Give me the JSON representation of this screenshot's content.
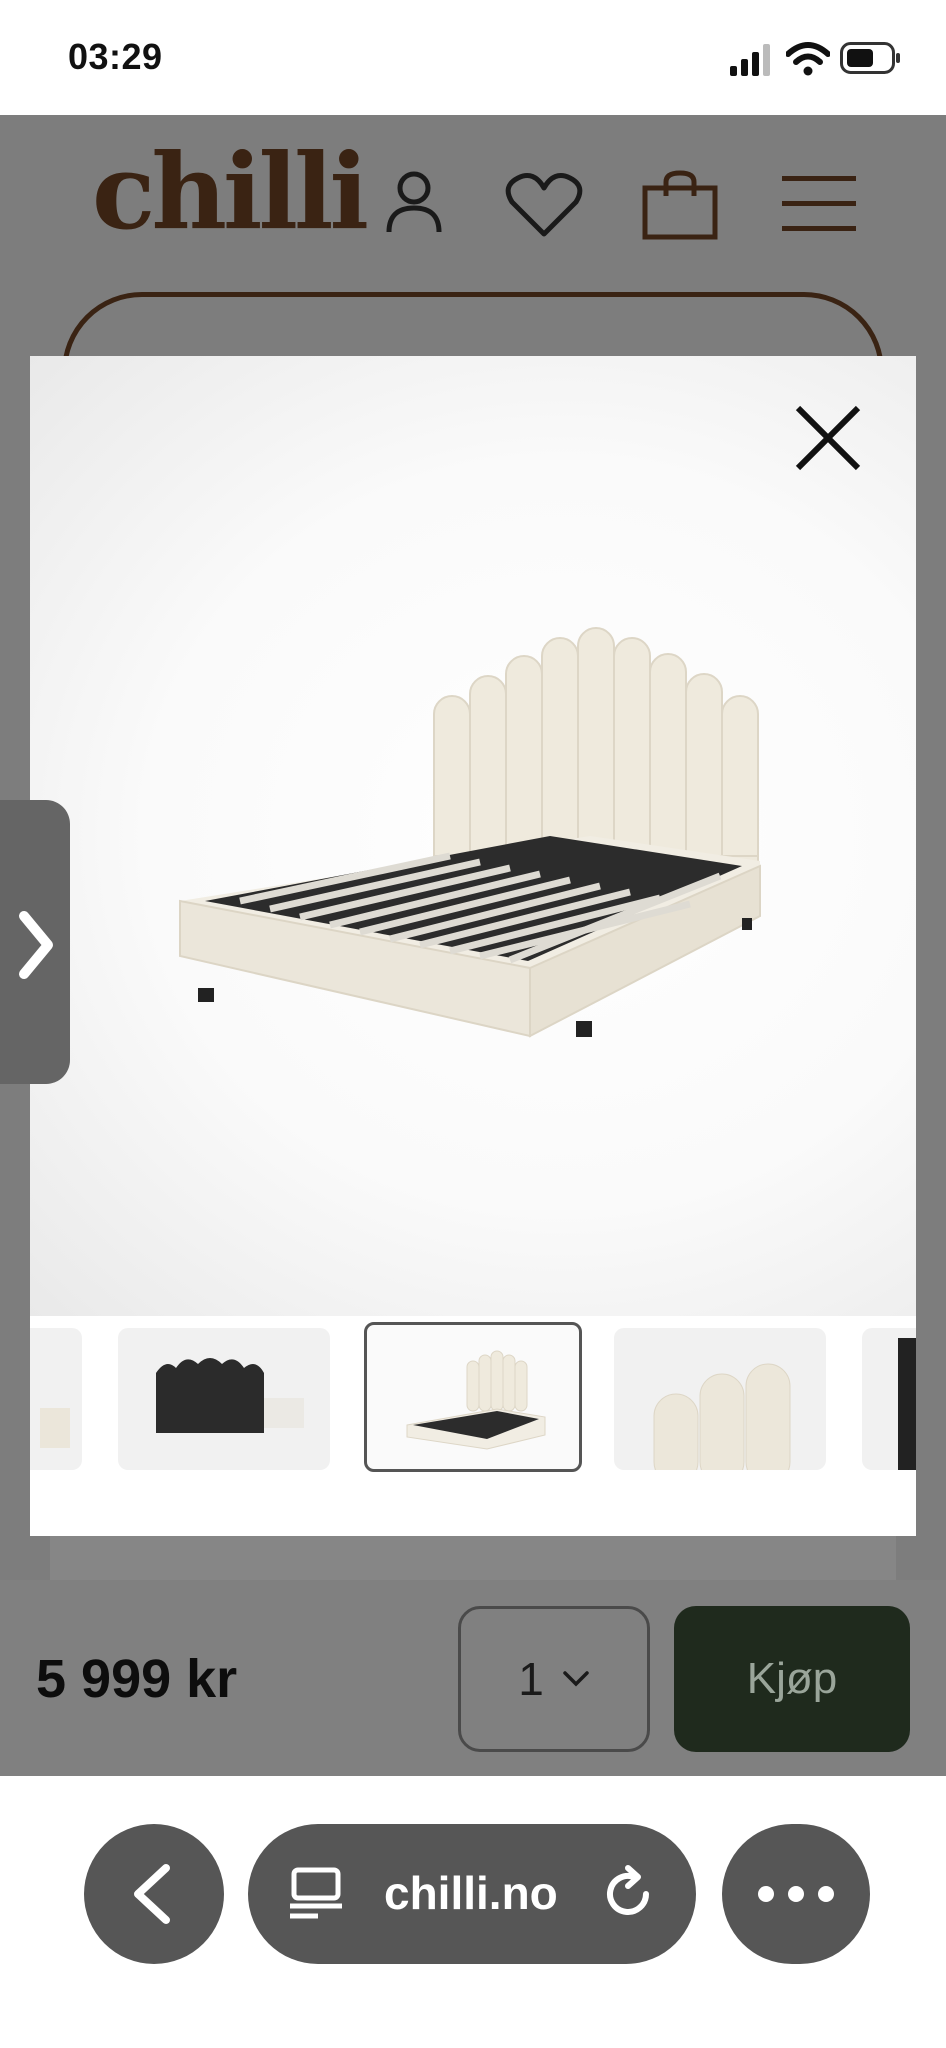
{
  "status_bar": {
    "time": "03:29"
  },
  "site": {
    "logo": "chilli",
    "header_icons": [
      "user-icon",
      "heart-icon",
      "shopping-bag-icon",
      "menu-icon"
    ]
  },
  "modal": {
    "close_icon": "close-icon",
    "next_icon": "chevron-right-icon",
    "thumbnails_count_visible": 5,
    "active_thumbnail_index": 2
  },
  "buy_bar": {
    "price": "5 999 kr",
    "quantity": "1",
    "buy_label": "Kjøp"
  },
  "browser": {
    "url": "chilli.no",
    "icons": [
      "back-icon",
      "page-icon",
      "reload-icon",
      "more-icon"
    ]
  },
  "colors": {
    "brand": "#3a2313",
    "buy_button": "#1f2a1d",
    "overlay": "#7d7d7d"
  }
}
